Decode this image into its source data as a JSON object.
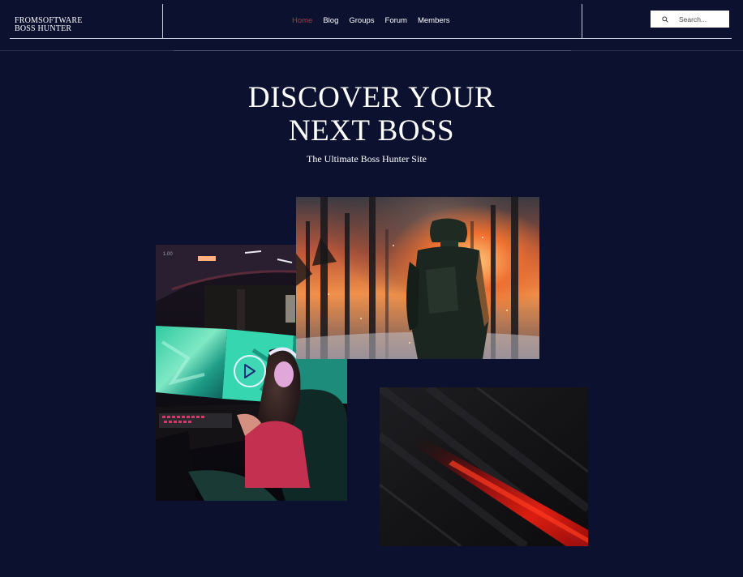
{
  "header": {
    "logo_line1": "FROMSOFTWARE",
    "logo_line2": "BOSS HUNTER",
    "nav": [
      {
        "label": "Home",
        "active": true
      },
      {
        "label": "Blog",
        "active": false
      },
      {
        "label": "Groups",
        "active": false
      },
      {
        "label": "Forum",
        "active": false
      },
      {
        "label": "Members",
        "active": false
      }
    ],
    "search": {
      "placeholder": "Search...",
      "icon": "search-icon"
    }
  },
  "hero": {
    "title_line1": "DISCOVER YOUR",
    "title_line2": "NEXT BOSS",
    "subtitle": "The Ultimate Boss Hunter Site"
  },
  "gallery": {
    "video": {
      "counter": "1.00",
      "play_icon": "play-icon"
    }
  },
  "colors": {
    "background": "#0c1130",
    "active_nav": "#a8384a",
    "text": "#ffffff"
  }
}
